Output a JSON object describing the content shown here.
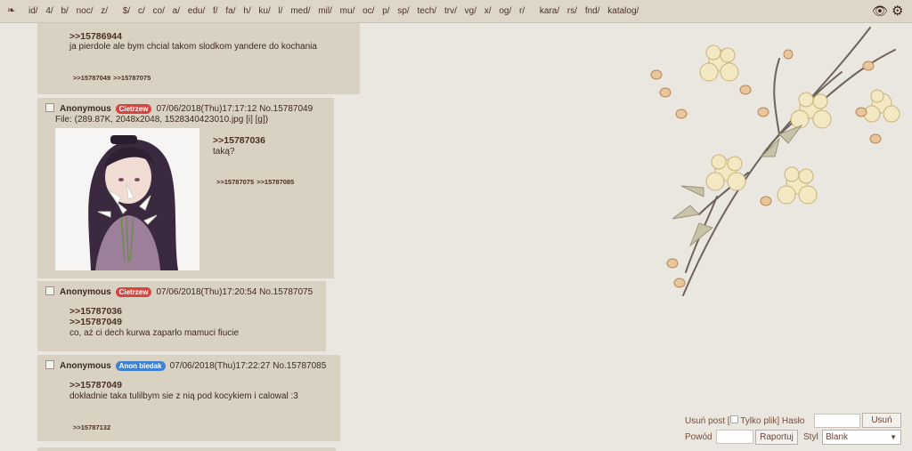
{
  "nav": {
    "items": [
      "id/",
      "4/",
      "b/",
      "noc/",
      "z/",
      "$/",
      "c/",
      "co/",
      "a/",
      "edu/",
      "f/",
      "fa/",
      "h/",
      "ku/",
      "l/",
      "med/",
      "mil/",
      "mu/",
      "oc/",
      "p/",
      "sp/",
      "tech/",
      "trv/",
      "vg/",
      "x/",
      "og/",
      "r/",
      "kara/",
      "rs/",
      "fnd/",
      "katalog/"
    ]
  },
  "posts": {
    "p0": {
      "quote": ">>15786944",
      "text": "ja pierdole ale bym chcial takom slodkom yandere do kochania",
      "backlinks": [
        ">>15787049",
        ">>15787075"
      ]
    },
    "p1": {
      "name": "Anonymous",
      "badge": "Cietrzew",
      "date": "07/06/2018(Thu)17:17:12",
      "no": "No.15787049",
      "file": "File: (289.87K, 2048x2048, 1528340423010.jpg [i] [g])",
      "quote": ">>15787036",
      "text": "taką?",
      "backlinks": [
        ">>15787075",
        ">>15787085"
      ]
    },
    "p2": {
      "name": "Anonymous",
      "badge": "Cietrzew",
      "date": "07/06/2018(Thu)17:20:54",
      "no": "No.15787075",
      "quotes": [
        ">>15787036",
        ">>15787049"
      ],
      "text": "co, aż ci dech kurwa zaparło mamuci fiucie"
    },
    "p3": {
      "name": "Anonymous",
      "badge": "Anon biedak",
      "date": "07/06/2018(Thu)17:22:27",
      "no": "No.15787085",
      "quote": ">>15787049",
      "text": "dokładnie taka tulilbym sie z nią pod kocykiem i calowal :3",
      "backlinks": [
        ">>15787132"
      ]
    }
  },
  "form": {
    "delete_label": "Usuń post [",
    "file_only_label": "Tylko plik] Hasło",
    "delete_button": "Usuń",
    "reason_label": "Powód",
    "report_button": "Raportuj",
    "style_label": "Styl",
    "style_value": "Blank"
  },
  "colors": {
    "badge_red": "#d6463e",
    "badge_blue": "#3f82d4",
    "post_bg": "#d9d2c3"
  }
}
